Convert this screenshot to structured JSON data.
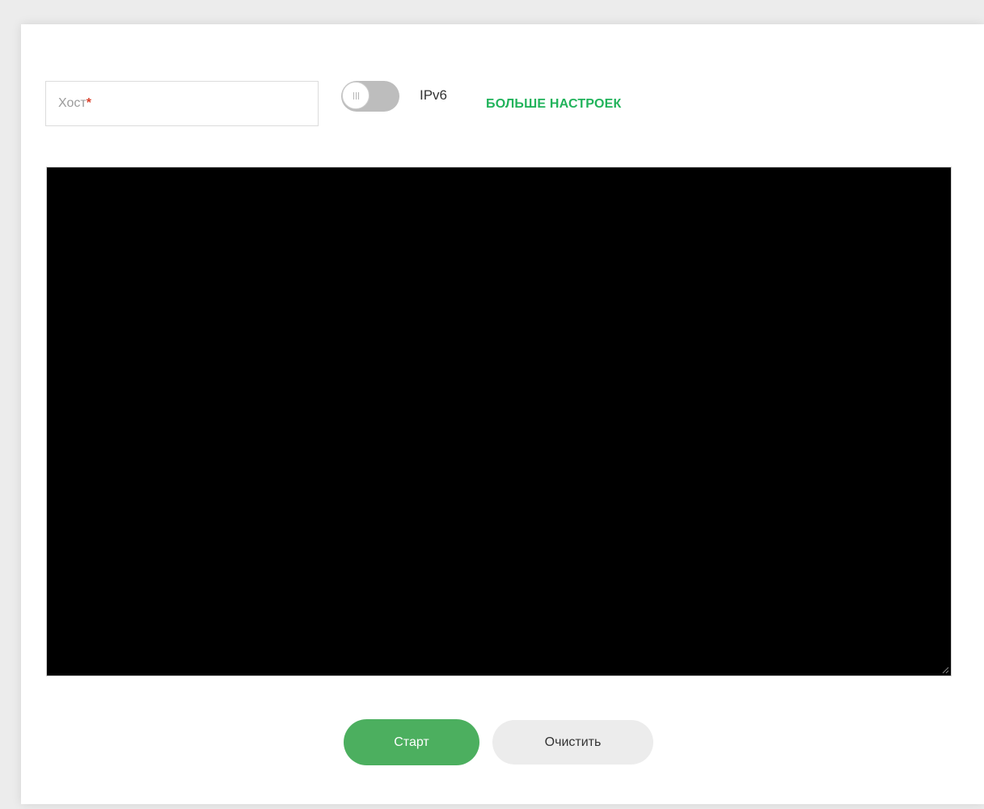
{
  "form": {
    "host": {
      "placeholder": "Хост",
      "required_mark": "*",
      "value": ""
    },
    "ipv6_toggle": {
      "label": "IPv6",
      "state": "off"
    },
    "more_settings_label": "БОЛЬШЕ НАСТРОЕК"
  },
  "output": {
    "text": ""
  },
  "actions": {
    "start_label": "Старт",
    "clear_label": "Очистить"
  },
  "colors": {
    "accent": "#21b35b",
    "start_button": "#4caf5f",
    "required": "#d9402b",
    "terminal_bg": "#000000"
  }
}
